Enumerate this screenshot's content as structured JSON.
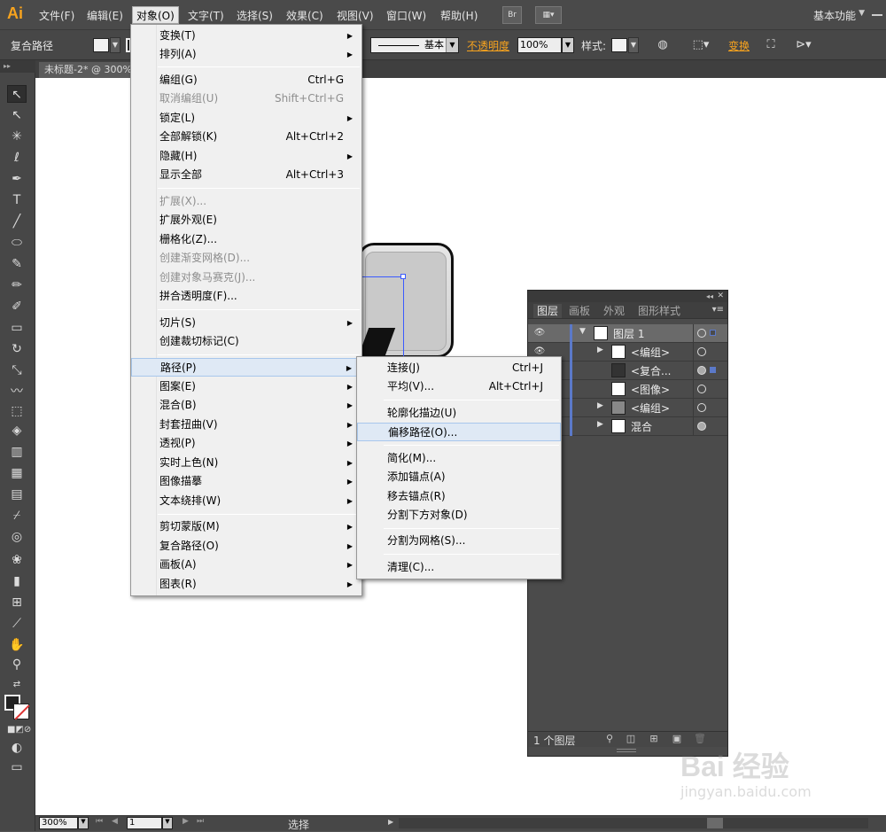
{
  "app": {
    "logo": "Ai"
  },
  "menubar": {
    "items": [
      "文件(F)",
      "编辑(E)",
      "对象(O)",
      "文字(T)",
      "选择(S)",
      "效果(C)",
      "视图(V)",
      "窗口(W)",
      "帮助(H)"
    ],
    "bridge_label": "Br",
    "workspace": "基本功能"
  },
  "controlbar": {
    "selection_label": "复合路径",
    "stroke_style": "基本",
    "opacity_label": "不透明度",
    "opacity_value": "100%",
    "style_label": "样式:",
    "transform_label": "变换"
  },
  "document": {
    "tab_title": "未标题-2* @ 300%"
  },
  "object_menu": {
    "items": [
      {
        "label": "变换(T)",
        "shortcut": "",
        "submenu": true,
        "disabled": false
      },
      {
        "label": "排列(A)",
        "shortcut": "",
        "submenu": true,
        "disabled": false
      },
      {
        "label": "编组(G)",
        "shortcut": "Ctrl+G",
        "submenu": false,
        "disabled": false
      },
      {
        "label": "取消编组(U)",
        "shortcut": "Shift+Ctrl+G",
        "submenu": false,
        "disabled": true
      },
      {
        "label": "锁定(L)",
        "shortcut": "",
        "submenu": true,
        "disabled": false
      },
      {
        "label": "全部解锁(K)",
        "shortcut": "Alt+Ctrl+2",
        "submenu": false,
        "disabled": false
      },
      {
        "label": "隐藏(H)",
        "shortcut": "",
        "submenu": true,
        "disabled": false
      },
      {
        "label": "显示全部",
        "shortcut": "Alt+Ctrl+3",
        "submenu": false,
        "disabled": false
      },
      {
        "label": "扩展(X)...",
        "shortcut": "",
        "submenu": false,
        "disabled": true
      },
      {
        "label": "扩展外观(E)",
        "shortcut": "",
        "submenu": false,
        "disabled": false
      },
      {
        "label": "栅格化(Z)...",
        "shortcut": "",
        "submenu": false,
        "disabled": false
      },
      {
        "label": "创建渐变网格(D)...",
        "shortcut": "",
        "submenu": false,
        "disabled": true
      },
      {
        "label": "创建对象马赛克(J)...",
        "shortcut": "",
        "submenu": false,
        "disabled": true
      },
      {
        "label": "拼合透明度(F)...",
        "shortcut": "",
        "submenu": false,
        "disabled": false
      },
      {
        "label": "切片(S)",
        "shortcut": "",
        "submenu": true,
        "disabled": false
      },
      {
        "label": "创建裁切标记(C)",
        "shortcut": "",
        "submenu": false,
        "disabled": false
      },
      {
        "label": "路径(P)",
        "shortcut": "",
        "submenu": true,
        "disabled": false
      },
      {
        "label": "图案(E)",
        "shortcut": "",
        "submenu": true,
        "disabled": false
      },
      {
        "label": "混合(B)",
        "shortcut": "",
        "submenu": true,
        "disabled": false
      },
      {
        "label": "封套扭曲(V)",
        "shortcut": "",
        "submenu": true,
        "disabled": false
      },
      {
        "label": "透视(P)",
        "shortcut": "",
        "submenu": true,
        "disabled": false
      },
      {
        "label": "实时上色(N)",
        "shortcut": "",
        "submenu": true,
        "disabled": false
      },
      {
        "label": "图像描摹",
        "shortcut": "",
        "submenu": true,
        "disabled": false
      },
      {
        "label": "文本绕排(W)",
        "shortcut": "",
        "submenu": true,
        "disabled": false
      },
      {
        "label": "剪切蒙版(M)",
        "shortcut": "",
        "submenu": true,
        "disabled": false
      },
      {
        "label": "复合路径(O)",
        "shortcut": "",
        "submenu": true,
        "disabled": false
      },
      {
        "label": "画板(A)",
        "shortcut": "",
        "submenu": true,
        "disabled": false
      },
      {
        "label": "图表(R)",
        "shortcut": "",
        "submenu": true,
        "disabled": false
      }
    ]
  },
  "path_menu": {
    "items": [
      {
        "label": "连接(J)",
        "shortcut": "Ctrl+J"
      },
      {
        "label": "平均(V)...",
        "shortcut": "Alt+Ctrl+J"
      },
      {
        "label": "轮廓化描边(U)",
        "shortcut": ""
      },
      {
        "label": "偏移路径(O)...",
        "shortcut": ""
      },
      {
        "label": "简化(M)...",
        "shortcut": ""
      },
      {
        "label": "添加锚点(A)",
        "shortcut": ""
      },
      {
        "label": "移去锚点(R)",
        "shortcut": ""
      },
      {
        "label": "分割下方对象(D)",
        "shortcut": ""
      },
      {
        "label": "分割为网格(S)...",
        "shortcut": ""
      },
      {
        "label": "清理(C)...",
        "shortcut": ""
      }
    ]
  },
  "layers_panel": {
    "tabs": [
      "图层",
      "画板",
      "外观",
      "图形样式"
    ],
    "rows": [
      {
        "name": "图层 1"
      },
      {
        "name": "<编组>"
      },
      {
        "name": "<复合..."
      },
      {
        "name": "<图像>"
      },
      {
        "name": "<编组>"
      },
      {
        "name": "混合"
      }
    ],
    "layer_count": "1 个图层",
    "accent_color": "#5b79c9"
  },
  "statusbar": {
    "zoom": "300%",
    "artboard": "1",
    "status": "选择"
  },
  "watermark": {
    "text": "Bai 经验",
    "url": "jingyan.baidu.com"
  }
}
